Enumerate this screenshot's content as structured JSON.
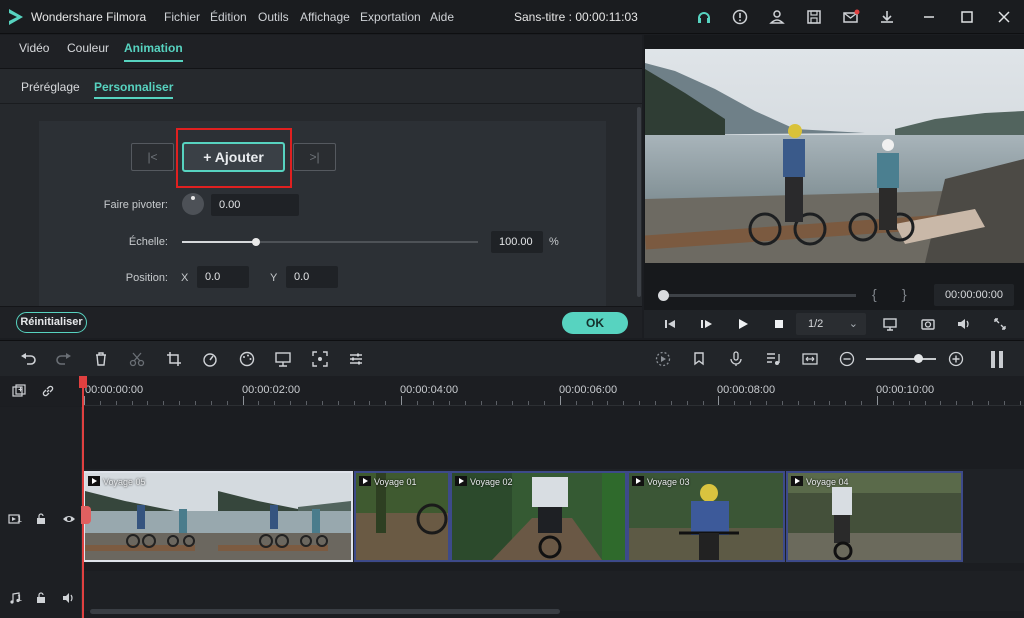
{
  "app": {
    "name": "Wondershare Filmora",
    "document_title": "Sans-titre : 00:00:11:03",
    "accent_color": "#57d3c0",
    "highlight_box_color": "#e02020"
  },
  "menu": [
    "Fichier",
    "Édition",
    "Outils",
    "Affichage",
    "Exportation",
    "Aide"
  ],
  "titlebar_icons": [
    "headset-icon",
    "info-icon",
    "account-icon",
    "save-icon",
    "mail-icon",
    "download-icon",
    "minimize-icon",
    "maximize-icon",
    "close-icon"
  ],
  "editor": {
    "tabs": [
      "Vidéo",
      "Couleur",
      "Animation"
    ],
    "active_tab": "Animation",
    "subtabs": [
      "Préréglage",
      "Personnaliser"
    ],
    "active_subtab": "Personnaliser",
    "prev_keyframe_glyph": "|<",
    "next_keyframe_glyph": ">|",
    "add_button": "+ Ajouter",
    "rotate_label": "Faire pivoter:",
    "rotate_value": "0.00",
    "scale_label": "Échelle:",
    "scale_value": "100.00",
    "scale_unit": "%",
    "scale_percent": 100,
    "position_label": "Position:",
    "x_label": "X",
    "x_value": "0.0",
    "y_label": "Y",
    "y_value": "0.0",
    "reset_button": "Réinitialiser",
    "ok_button": "OK"
  },
  "preview": {
    "timecode": "00:00:00:00",
    "brace_open": "{",
    "brace_close": "}",
    "progress_percent": 0,
    "speed": "1/2"
  },
  "timeline": {
    "ruler_labels": [
      "00:00:00:00",
      "00:00:02:00",
      "00:00:04:00",
      "00:00:06:00",
      "00:00:08:00",
      "00:00:10:00"
    ],
    "video_track_label": "1",
    "audio_track_label": "1",
    "clips": [
      {
        "name": "Voyage 05",
        "selected": true
      },
      {
        "name": "Voyage 01",
        "selected": false
      },
      {
        "name": "Voyage 02",
        "selected": false
      },
      {
        "name": "Voyage 03",
        "selected": false
      },
      {
        "name": "Voyage 04",
        "selected": false
      }
    ]
  }
}
